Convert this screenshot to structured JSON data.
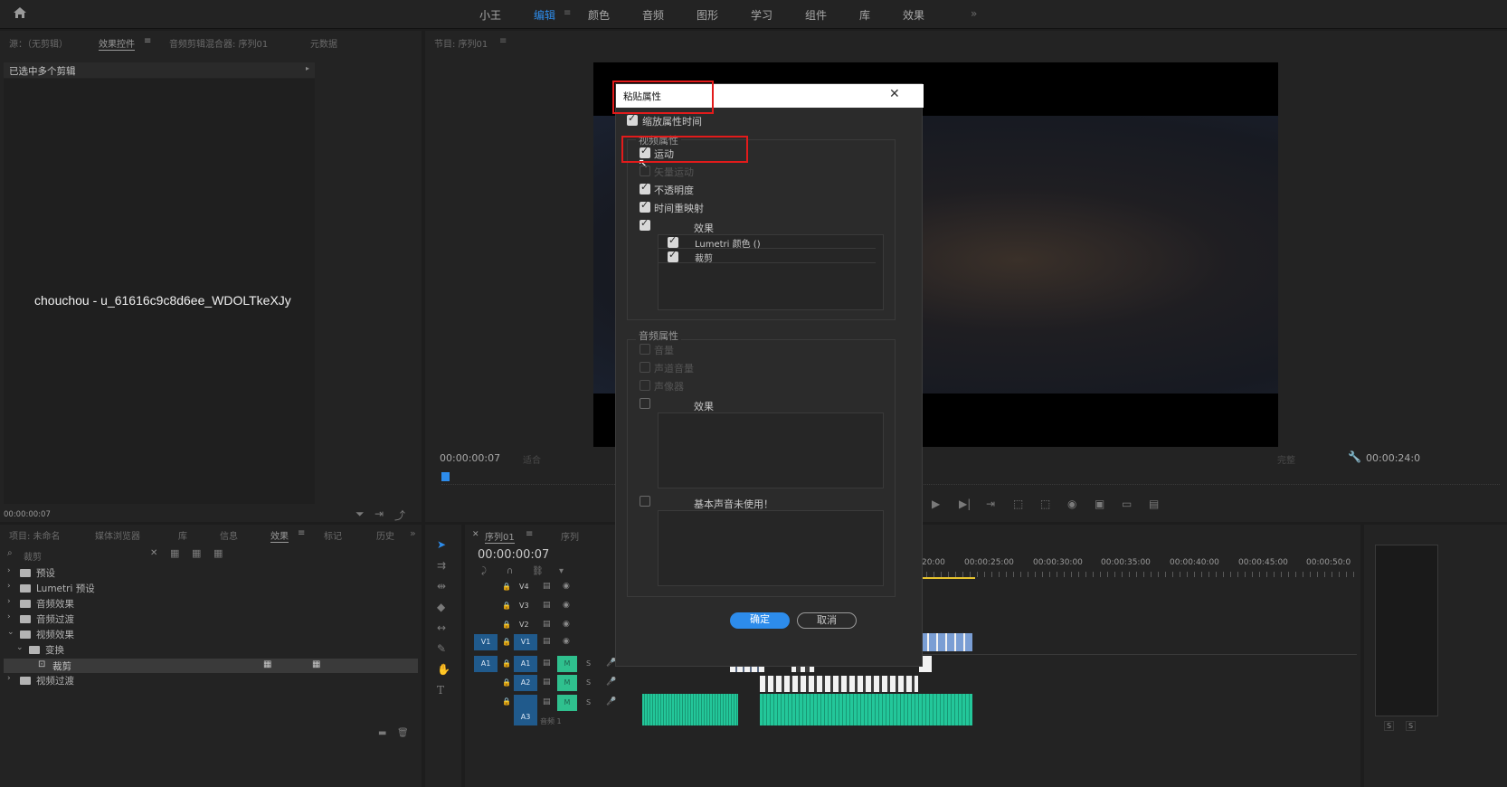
{
  "workspaces": [
    "小王",
    "编辑",
    "颜色",
    "音频",
    "图形",
    "学习",
    "组件",
    "库",
    "效果"
  ],
  "active_workspace": "编辑",
  "overflow": "»",
  "source_panel": {
    "tabs": [
      "源：（无剪辑）",
      "效果控件",
      "音频剪辑混合器: 序列01",
      "元数据"
    ],
    "selected_info": "已选中多个剪辑",
    "watermark": "chouchou - u_61616c9c8d6ee_WDOLTkeXJy",
    "timecode": "00:00:00:07"
  },
  "program_panel": {
    "title": "节目: 序列01",
    "timecode": "00:00:00:07",
    "fit": "适合",
    "quality": "完整",
    "duration": "00:00:24:0"
  },
  "project_panel": {
    "tabs": [
      "项目: 未命名",
      "媒体浏览器",
      "库",
      "信息",
      "效果",
      "标记",
      "历史"
    ],
    "search_value": "裁剪",
    "tree": [
      {
        "label": "预设",
        "expanded": false
      },
      {
        "label": "Lumetri 预设",
        "expanded": false
      },
      {
        "label": "音频效果",
        "expanded": false
      },
      {
        "label": "音频过渡",
        "expanded": false
      },
      {
        "label": "视频效果",
        "expanded": true
      },
      {
        "label": "变换",
        "expanded": true
      },
      {
        "label": "裁剪",
        "selected": true
      },
      {
        "label": "视频过渡",
        "expanded": false
      }
    ]
  },
  "dialog": {
    "title": "粘贴属性",
    "scale_attr": "缩放属性时间",
    "video_section": "视频属性",
    "video_items": [
      {
        "label": "运动",
        "checked": true
      },
      {
        "label": "矢量运动",
        "checked": false,
        "disabled": true
      },
      {
        "label": "不透明度",
        "checked": true
      },
      {
        "label": "时间重映射",
        "checked": true
      }
    ],
    "effects_header": "效果",
    "video_effects": [
      "Lumetri 颜色 ()",
      "裁剪"
    ],
    "audio_section": "音频属性",
    "audio_items": [
      "音量",
      "声道音量",
      "声像器"
    ],
    "audio_effects_header": "效果",
    "essential_sound": "基本声音未使用！",
    "ok": "确定",
    "cancel": "取消",
    "close": "✕"
  },
  "timeline": {
    "tabs": [
      "序列01",
      "序列"
    ],
    "timecode": "00:00:00:07",
    "video_tracks": [
      "V4",
      "V3",
      "V2",
      "V1"
    ],
    "audio_tracks": [
      "A1",
      "A2",
      "A3"
    ],
    "source_v": "V1",
    "source_a": "A1",
    "mute_label": "M",
    "solo_label": "S",
    "master_label": "音频 1",
    "ruler": [
      "00:00:20:00",
      "00:00:25:00",
      "00:00:30:00",
      "00:00:35:00",
      "00:00:40:00",
      "00:00:45:00",
      "00:00:50:0"
    ]
  },
  "colors": {
    "accent": "#2d8ceb",
    "highlight": "#e21b1b",
    "audio_clip": "#23c79a",
    "video_clip": "#7a9ed4"
  }
}
